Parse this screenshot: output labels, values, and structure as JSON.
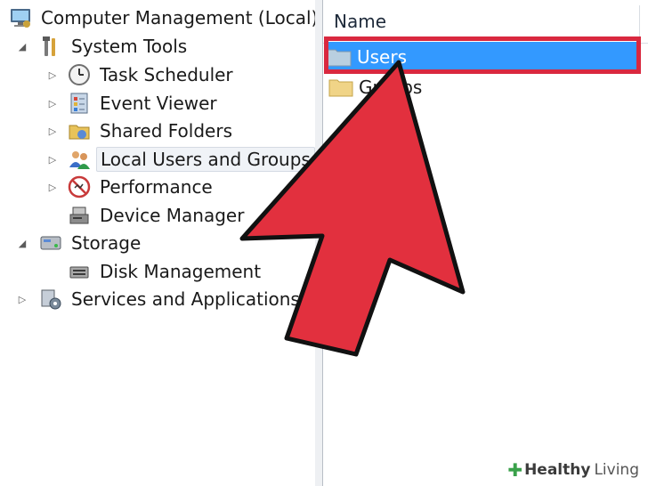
{
  "tree": {
    "root": "Computer Management (Local)",
    "system_tools": "System Tools",
    "task_scheduler": "Task Scheduler",
    "event_viewer": "Event Viewer",
    "shared_folders": "Shared Folders",
    "local_users_groups": "Local Users and Groups",
    "performance": "Performance",
    "device_manager": "Device Manager",
    "storage": "Storage",
    "disk_management": "Disk Management",
    "services_apps": "Services and Applications",
    "expander_collapsed": "▷",
    "expander_expanded": "◢"
  },
  "list": {
    "column_name": "Name",
    "items": [
      "Users",
      "Groups"
    ]
  },
  "watermark": {
    "brand": "Healthy",
    "brand_light": "Living"
  },
  "colors": {
    "selection": "#3399ff",
    "highlight_red": "#d9283f",
    "arrow_red": "#e2303e"
  }
}
